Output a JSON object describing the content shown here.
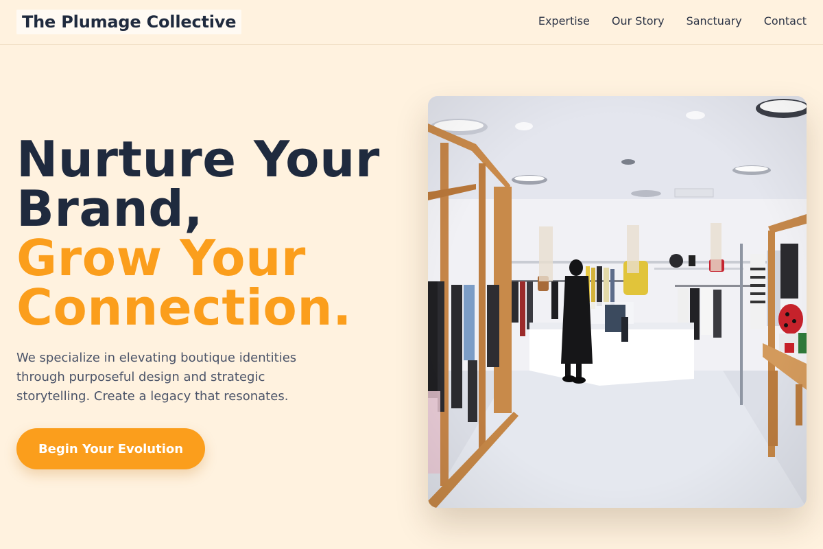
{
  "header": {
    "logo": "The Plumage Collective",
    "nav": [
      "Expertise",
      "Our Story",
      "Sanctuary",
      "Contact"
    ]
  },
  "hero": {
    "title_line1": "Nurture Your",
    "title_line2": "Brand,",
    "title_line3": "Grow Your",
    "title_line4": "Connection.",
    "description": "We specialize in elevating boutique identities through purposeful design and strategic storytelling. Create a legacy that resonates.",
    "cta_label": "Begin Your Evolution"
  },
  "image": {
    "subject": "boutique clothing store interior with a shopper"
  },
  "colors": {
    "background": "#fff2df",
    "primary_text": "#1f2a3e",
    "accent": "#fb9e1c"
  }
}
